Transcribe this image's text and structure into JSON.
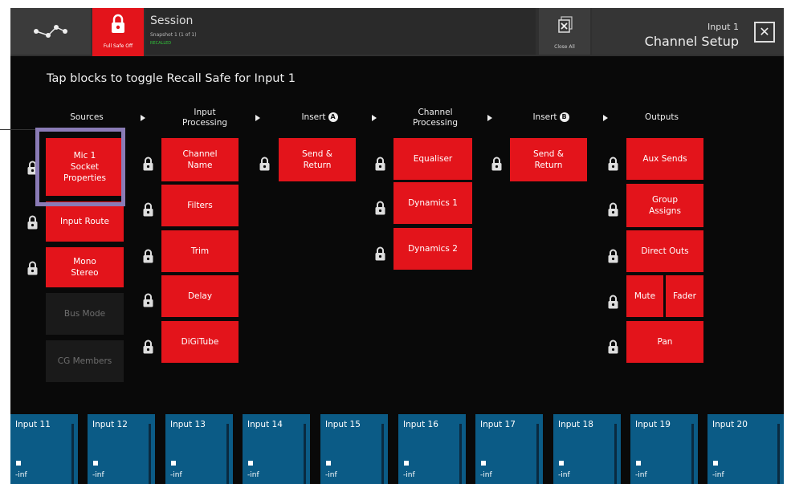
{
  "topbar": {
    "failsafe_label": "Full Safe Off",
    "session_title": "Session",
    "session_snapshot": "Snapshot 1 (1 of 1)",
    "session_status": "RECALLED",
    "close_all_label": "Close All",
    "input_label": "Input 1",
    "page_title": "Channel Setup",
    "close_glyph": "✕"
  },
  "instruction": "Tap blocks to toggle Recall Safe for Input 1",
  "headers": {
    "sources": "Sources",
    "input_processing": [
      "Input",
      "Processing"
    ],
    "insert_a": "Insert",
    "insert_a_badge": "A",
    "channel_processing": [
      "Channel",
      "Processing"
    ],
    "insert_b": "Insert",
    "insert_b_badge": "B",
    "outputs": "Outputs"
  },
  "sources": {
    "mic_socket": [
      "Mic 1",
      "Socket",
      "Properties"
    ],
    "input_route": "Input Route",
    "mono_stereo": [
      "Mono",
      "Stereo"
    ],
    "bus_mode": "Bus Mode",
    "cg_members": "CG Members"
  },
  "input_processing": {
    "channel_name": [
      "Channel",
      "Name"
    ],
    "filters": "Filters",
    "trim": "Trim",
    "delay": "Delay",
    "digitube": "DiGiTube"
  },
  "insert_a": {
    "send_return": [
      "Send &",
      "Return"
    ]
  },
  "channel_processing": {
    "equaliser": "Equaliser",
    "dynamics1": "Dynamics 1",
    "dynamics2": "Dynamics 2"
  },
  "insert_b": {
    "send_return": [
      "Send &",
      "Return"
    ]
  },
  "outputs": {
    "aux_sends": "Aux Sends",
    "group_assigns": [
      "Group",
      "Assigns"
    ],
    "direct_outs": "Direct Outs",
    "mute": "Mute",
    "fader": "Fader",
    "pan": "Pan"
  },
  "strip": [
    {
      "name": "Input 11",
      "value": "-inf"
    },
    {
      "name": "Input 12",
      "value": "-inf"
    },
    {
      "name": "Input 13",
      "value": "-inf"
    },
    {
      "name": "Input 14",
      "value": "-inf"
    },
    {
      "name": "Input 15",
      "value": "-inf"
    },
    {
      "name": "Input 16",
      "value": "-inf"
    },
    {
      "name": "Input 17",
      "value": "-inf"
    },
    {
      "name": "Input 18",
      "value": "-inf"
    },
    {
      "name": "Input 19",
      "value": "-inf"
    },
    {
      "name": "Input 20",
      "value": "-inf"
    }
  ],
  "colors": {
    "active_red": "#e3141b",
    "tile_blue": "#0b5b86",
    "highlight": "#8a7bb6"
  },
  "icons": {
    "network": "network-icon",
    "lock": "padlock-icon",
    "close_all": "close-all-icon",
    "close": "close-icon"
  }
}
